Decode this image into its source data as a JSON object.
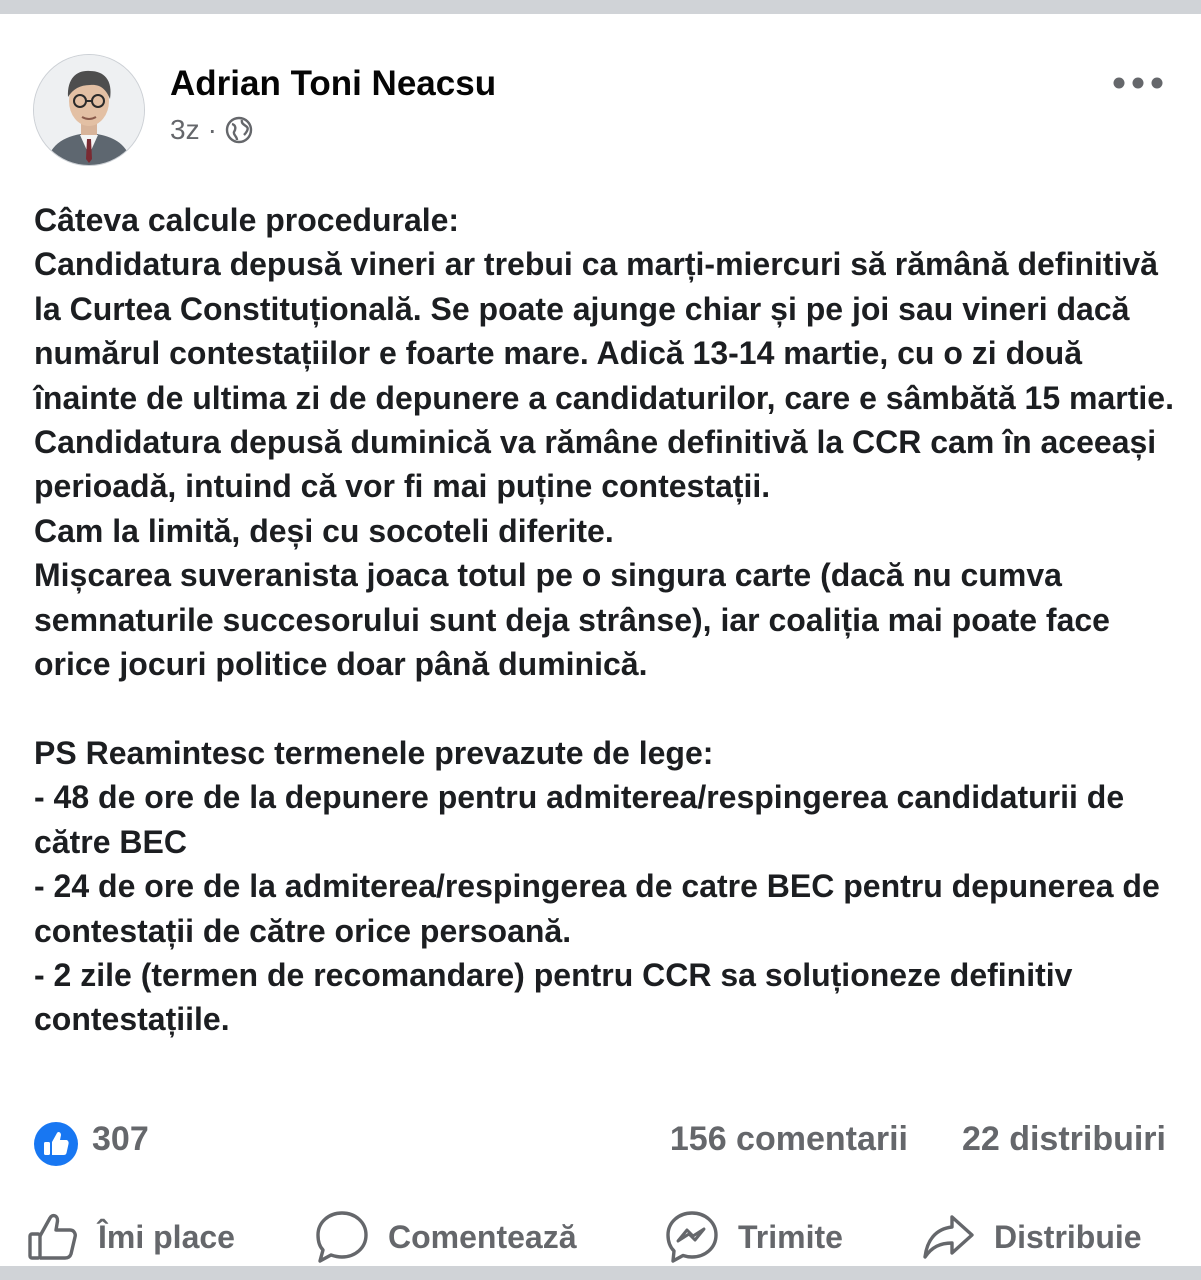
{
  "post": {
    "author": "Adrian Toni Neacsu",
    "time": "3z",
    "separator": "·",
    "audience_icon": "globe-icon",
    "text": "Câteva calcule procedurale:\nCandidatura depusă vineri ar trebui ca marți-miercuri să rămână definitivă la Curtea Constituțională. Se poate ajunge chiar și pe joi sau vineri dacă numărul contestațiilor e foarte mare. Adică 13-14 martie, cu o zi două  înainte de ultima zi de depunere a candidaturilor, care e sâmbătă 15 martie.\nCandidatura depusă duminică va rămâne definitivă la CCR cam în aceeași perioadă, intuind că vor fi mai puține contestații.\nCam la limită, deși cu socoteli diferite.\nMișcarea suveranista joaca totul pe o singura carte (dacă nu cumva semnaturile succesorului sunt deja strânse), iar coaliția mai poate face orice jocuri politice doar până duminică.\n\nPS Reamintesc termenele prevazute de lege:\n- 48 de ore de la depunere pentru admiterea/respingerea candidaturii de către BEC\n- 24 de ore de la admiterea/respingerea de catre BEC pentru depunerea de contestații de către orice persoană.\n- 2 zile (termen de recomandare) pentru CCR sa soluționeze definitiv contestațiile."
  },
  "stats": {
    "reactions": "307",
    "comments": "156 comentarii",
    "shares": "22 distribuiri"
  },
  "actions": {
    "like": "Îmi place",
    "comment": "Comentează",
    "send": "Trimite",
    "share": "Distribuie"
  },
  "colors": {
    "like_blue": "#1877f2",
    "secondary_text": "#65676b",
    "primary_text": "#1c1e21"
  }
}
